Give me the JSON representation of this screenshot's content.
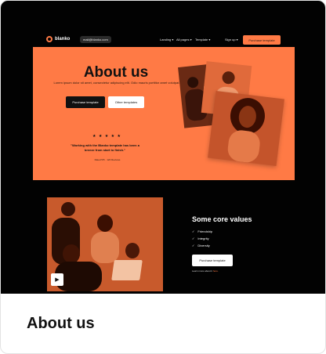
{
  "nav": {
    "brand": "blanko",
    "email": "mail@blanko.com",
    "links": [
      "Landing ▾",
      "All pages ▾",
      "Template ▾",
      "Sign up ▾"
    ],
    "cta": "Purchase template"
  },
  "hero": {
    "title": "About us",
    "subtitle": "Lorem ipsum dolor sit amet, consectetur adipiscing elit. Odio mauris porttitor amet volutpat.",
    "primary_button": "Purchase template",
    "secondary_button": "Other templates",
    "rating_stars": "★ ★ ★ ★ ★",
    "quote": "\"Working with the Blanko template has been a breeze from start to finish.\"",
    "quote_author": "Rated 5/5 · 120 Reviews"
  },
  "values": {
    "title": "Some core values",
    "items": [
      "Friendship",
      "Integrity",
      "Diversity"
    ],
    "check_icon": "✓",
    "button": "Purchase template",
    "learn_more": "Learn more about it",
    "learn_link": "here."
  },
  "caption": "About us",
  "colors": {
    "accent": "#ff7a45",
    "dark": "#020202"
  }
}
